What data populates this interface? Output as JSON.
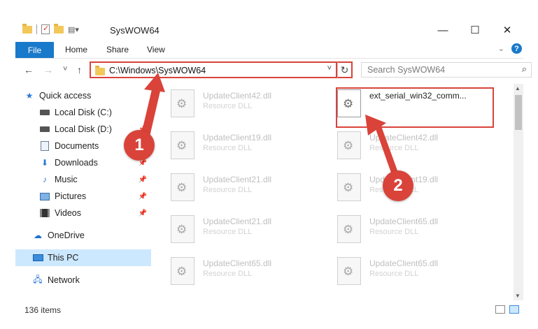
{
  "window": {
    "title": "SysWOW64",
    "controls": {
      "minimize": "—",
      "maximize": "☐",
      "close": "✕"
    }
  },
  "ribbon": {
    "tabs": [
      "File",
      "Home",
      "Share",
      "View"
    ],
    "expand_icon": "chevron-down-icon",
    "help_label": "?"
  },
  "nav": {
    "back": "←",
    "forward": "→",
    "recent": "˅",
    "up": "↑",
    "address": "C:\\Windows\\SysWOW64",
    "address_dropdown": "˅",
    "refresh": "↻",
    "search_placeholder": "Search SysWOW64",
    "search_icon": "⌕"
  },
  "sidebar": {
    "items": [
      {
        "label": "Quick access",
        "icon": "star-icon"
      },
      {
        "label": "Local Disk (C:)",
        "icon": "disk-icon",
        "pinned": true
      },
      {
        "label": "Local Disk (D:)",
        "icon": "disk-icon",
        "pinned": true
      },
      {
        "label": "Documents",
        "icon": "document-icon",
        "pinned": true
      },
      {
        "label": "Downloads",
        "icon": "download-icon",
        "pinned": true
      },
      {
        "label": "Music",
        "icon": "music-icon",
        "pinned": true
      },
      {
        "label": "Pictures",
        "icon": "picture-icon",
        "pinned": true
      },
      {
        "label": "Videos",
        "icon": "video-icon",
        "pinned": true
      },
      {
        "label": "OneDrive",
        "icon": "cloud-icon"
      },
      {
        "label": "This PC",
        "icon": "computer-icon",
        "selected": true
      },
      {
        "label": "Network",
        "icon": "network-icon"
      }
    ]
  },
  "files": {
    "col1": [
      {
        "name": "UpdateClient42.dll",
        "type": "Resource DLL"
      },
      {
        "name": "UpdateClient19.dll",
        "type": "Resource DLL"
      },
      {
        "name": "UpdateClient21.dll",
        "type": "Resource DLL"
      },
      {
        "name": "UpdateClient21.dll",
        "type": "Resource DLL"
      },
      {
        "name": "UpdateClient65.dll",
        "type": "Resource DLL"
      }
    ],
    "col2": [
      {
        "name": "ext_serial_win32_comm...",
        "type": "",
        "highlighted": true
      },
      {
        "name": "UpdateClient42.dll",
        "type": "Resource DLL"
      },
      {
        "name": "UpdateClient19.dll",
        "type": "Resource DLL"
      },
      {
        "name": "UpdateClient65.dll",
        "type": "Resource DLL"
      },
      {
        "name": "UpdateClient65.dll",
        "type": "Resource DLL"
      }
    ]
  },
  "status": {
    "item_count": "136 items"
  },
  "annotations": {
    "step1": "1",
    "step2": "2",
    "color": "#d9433a"
  }
}
